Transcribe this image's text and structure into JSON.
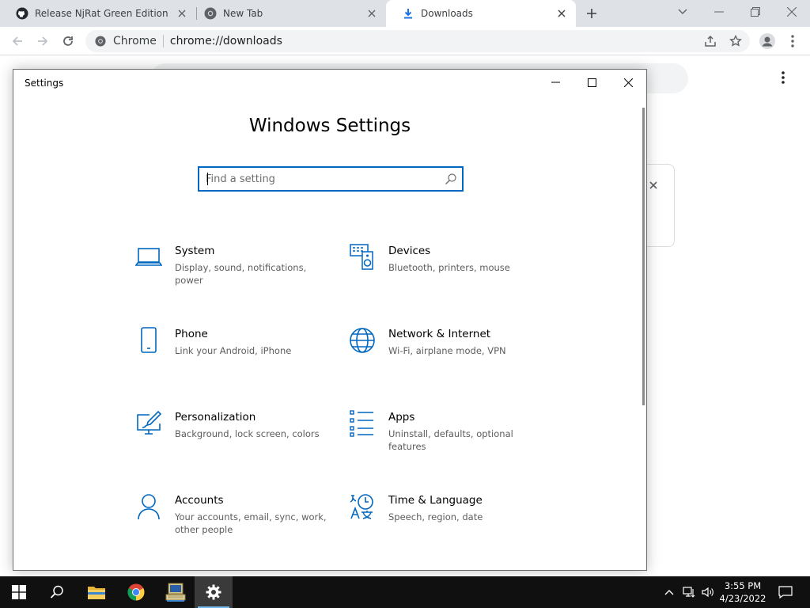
{
  "browser": {
    "tabs": [
      {
        "title": "Release NjRat Green Edition · Th",
        "icon": "github-icon"
      },
      {
        "title": "New Tab",
        "icon": "chrome-icon"
      },
      {
        "title": "Downloads",
        "icon": "download-icon"
      }
    ],
    "omnibox": {
      "site_name": "Chrome",
      "url": "chrome://downloads"
    }
  },
  "settings_window": {
    "title": "Settings",
    "heading": "Windows Settings",
    "search_placeholder": "Find a setting",
    "categories": [
      {
        "name": "System",
        "desc": "Display, sound, notifications, power",
        "icon": "laptop-icon"
      },
      {
        "name": "Devices",
        "desc": "Bluetooth, printers, mouse",
        "icon": "devices-icon"
      },
      {
        "name": "Phone",
        "desc": "Link your Android, iPhone",
        "icon": "phone-icon"
      },
      {
        "name": "Network & Internet",
        "desc": "Wi-Fi, airplane mode, VPN",
        "icon": "globe-icon"
      },
      {
        "name": "Personalization",
        "desc": "Background, lock screen, colors",
        "icon": "personalization-icon"
      },
      {
        "name": "Apps",
        "desc": "Uninstall, defaults, optional features",
        "icon": "apps-icon"
      },
      {
        "name": "Accounts",
        "desc": "Your accounts, email, sync, work, other people",
        "icon": "person-icon"
      },
      {
        "name": "Time & Language",
        "desc": "Speech, region, date",
        "icon": "time-language-icon"
      }
    ]
  },
  "taskbar": {
    "clock_time": "3:55 PM",
    "clock_date": "4/23/2022"
  },
  "colors": {
    "accent": "#0067c0",
    "taskbar": "#101010",
    "tabstrip": "#dee1e6"
  }
}
